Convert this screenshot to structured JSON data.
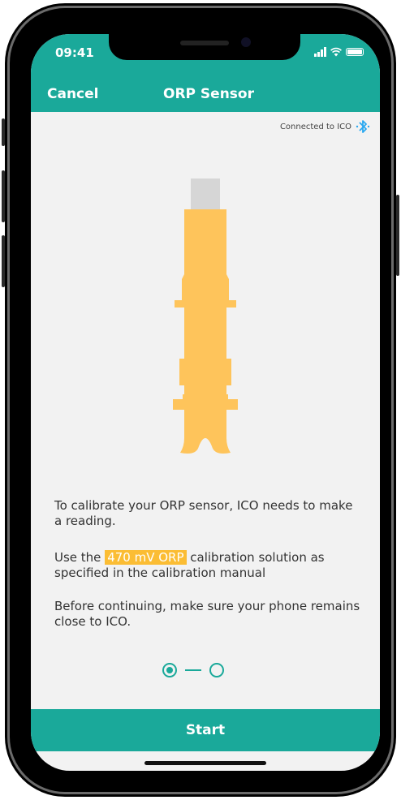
{
  "status": {
    "time": "09:41"
  },
  "nav": {
    "cancel_label": "Cancel",
    "title": "ORP Sensor"
  },
  "connection": {
    "text": "Connected to ICO",
    "icon": "bluetooth-icon"
  },
  "instructions": {
    "p1": "To calibrate your ORP sensor, ICO needs to make a reading.",
    "p2_prefix": "Use the ",
    "p2_highlight": "470 mV ORP",
    "p2_suffix": " calibration solution as specified in the calibration manual",
    "p3": "Before continuing, make sure your phone remains close to ICO."
  },
  "stepper": {
    "total": 2,
    "current": 1
  },
  "actions": {
    "start_label": "Start"
  },
  "colors": {
    "accent": "#1aa99a",
    "highlight": "#fbbd34",
    "sensor": "#fec45b"
  }
}
